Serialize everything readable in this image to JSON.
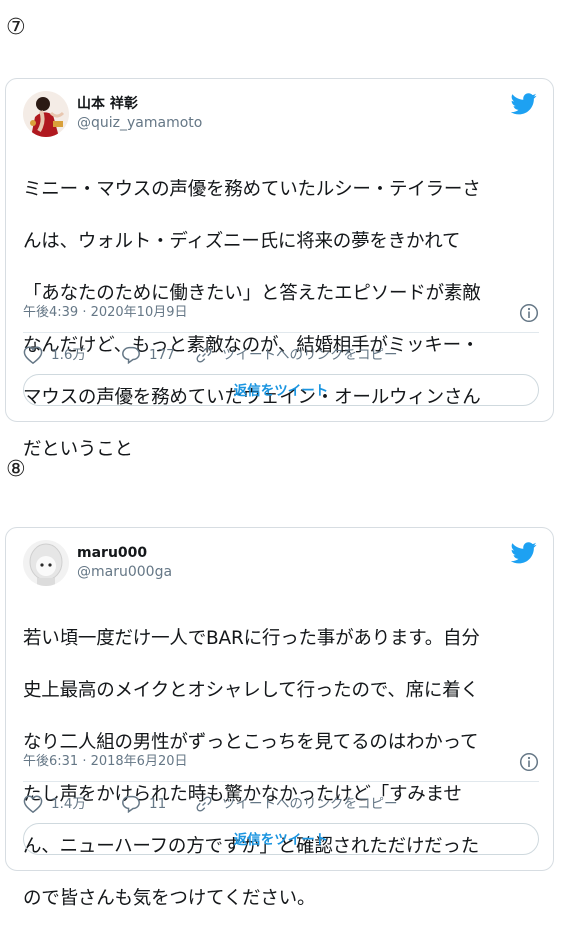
{
  "sections": [
    {
      "number": "⑦",
      "tweet": {
        "user_name": "山本 祥彰",
        "user_handle": "@quiz_yamamoto",
        "text": "ミニー・マウスの声優を務めていたルシー・テイラーさんは、ウォルト・ディズニー氏に将来の夢をきかれて「あなたのために働きたい」と答えたエピソードが素敵なんだけど、もっと素敵なのが、結婚相手がミッキー・マウスの声優を務めていたウェイン・オールウィンさんだということ",
        "text_lines": [
          "ミニー・マウスの声優を務めていたルシー・テイラーさ",
          "んは、ウォルト・ディズニー氏に将来の夢をきかれて",
          "「あなたのために働きたい」と答えたエピソードが素敵",
          "なんだけど、もっと素敵なのが、結婚相手がミッキー・",
          "マウスの声優を務めていたウェイン・オールウィンさん",
          "だということ"
        ],
        "timestamp": "午後4:39 · 2020年10月9日",
        "likes": "1.6万",
        "replies": "177",
        "copy_link_label": "ツイートへのリンクをコピー",
        "reply_button_label": "返信をツイート"
      }
    },
    {
      "number": "⑧",
      "tweet": {
        "user_name": "maru000",
        "user_handle": "@maru000ga",
        "text_lines": [
          "若い頃一度だけ一人でBARに行った事があります。自分",
          "史上最高のメイクとオシャレして行ったので、席に着く",
          "なり二人組の男性がずっとこっちを見てるのはわかって",
          "たし声をかけられた時も驚かなかったけど「すみませ",
          "ん、ニューハーフの方ですか」と確認されただけだった",
          "ので皆さんも気をつけてください。"
        ],
        "timestamp": "午後6:31 · 2018年6月20日",
        "likes": "1.4万",
        "replies": "11",
        "copy_link_label": "ツイートへのリンクをコピー",
        "reply_button_label": "返信をツイート"
      }
    }
  ],
  "colors": {
    "twitter_blue": "#1da1f2",
    "reply_text_blue": "#1b95e0",
    "secondary_text": "#657786",
    "border": "#d7dde2"
  },
  "icons": [
    "twitter-bird-icon",
    "info-icon",
    "heart-icon",
    "reply-bubble-icon",
    "link-icon"
  ]
}
